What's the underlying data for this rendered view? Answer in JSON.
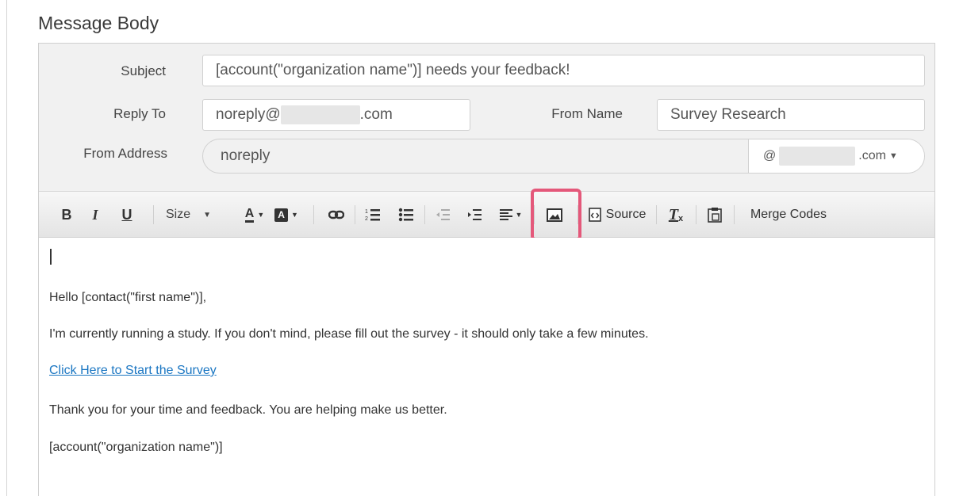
{
  "section": {
    "title": "Message Body"
  },
  "fields": {
    "subject_label": "Subject",
    "subject_value": "[account(\"organization name\")] needs your feedback!",
    "reply_to_label": "Reply To",
    "reply_to_prefix": "noreply@",
    "reply_to_suffix": ".com",
    "from_name_label": "From Name",
    "from_name_value": "Survey Research",
    "from_address_label": "From Address",
    "from_address_value": "noreply",
    "domain_prefix": "@",
    "domain_suffix": ".com"
  },
  "toolbar": {
    "bold": "B",
    "italic": "I",
    "underline": "U",
    "size": "Size",
    "source": "Source",
    "merge_codes": "Merge Codes"
  },
  "editor": {
    "greeting": "Hello [contact(\"first name\")],",
    "body": "I'm currently running a study. If you don't mind, please fill out the survey - it should only take a few minutes.",
    "link_text": "Click Here to Start the Survey",
    "thanks": "Thank you for your time and feedback. You are helping make us better.",
    "signature": "[account(\"organization name\")]"
  },
  "colors": {
    "highlight": "#e4587a",
    "link": "#1a76c2"
  }
}
